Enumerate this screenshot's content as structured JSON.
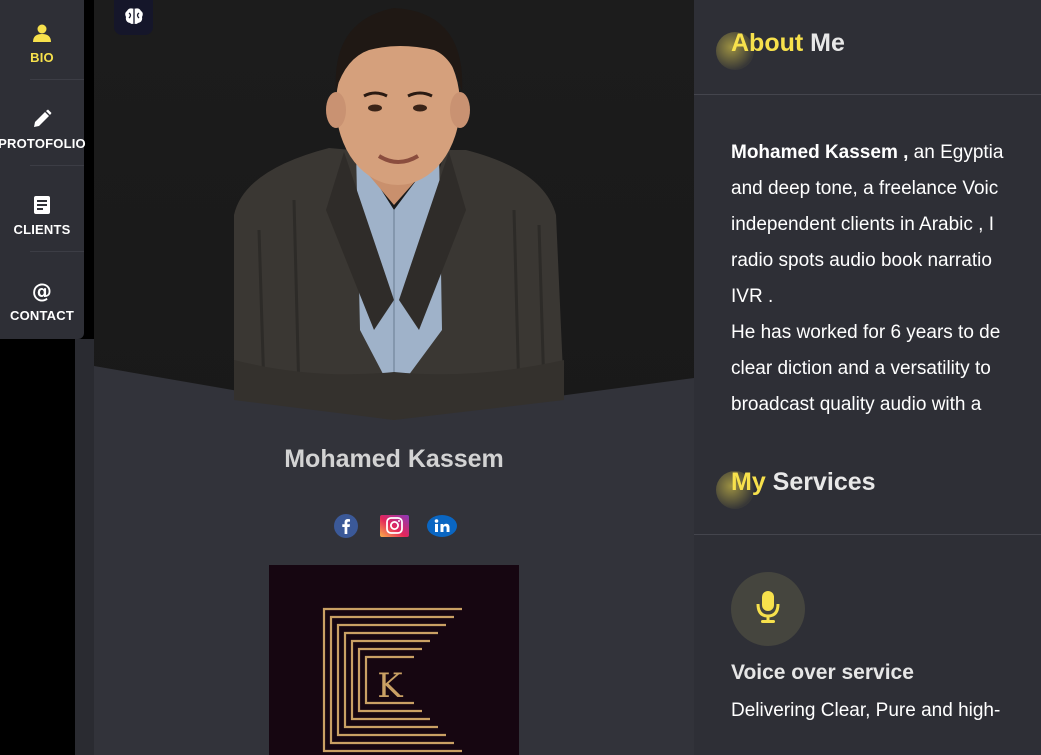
{
  "menu": {
    "items": [
      {
        "label": "BIO",
        "icon": "user-icon",
        "active": true
      },
      {
        "label": "PROTOFOLIO",
        "icon": "pencil-icon",
        "active": false
      },
      {
        "label": "CLIENTS",
        "icon": "document-icon",
        "active": false
      },
      {
        "label": "CONTACT",
        "icon": "at-icon",
        "active": false
      }
    ]
  },
  "profile": {
    "name": "Mohamed Kassem",
    "toolbar_icon": "brain-icon",
    "socials": [
      {
        "icon": "facebook-icon"
      },
      {
        "icon": "instagram-icon"
      },
      {
        "icon": "linkedin-icon"
      }
    ],
    "logo": {
      "letter": "K",
      "color": "#c9a064",
      "background": "#160611"
    }
  },
  "about": {
    "title_highlight": "About",
    "title_rest": " Me",
    "paragraph_lines": [
      {
        "bold": "Mohamed Kassem ,",
        "text": " an Egyptia"
      },
      {
        "bold": "",
        "text": "and deep tone, a freelance Voic"
      },
      {
        "bold": "",
        "text": "independent clients in Arabic , I"
      },
      {
        "bold": "",
        "text": "radio spots audio book narratio"
      },
      {
        "bold": "",
        "text": "IVR ."
      },
      {
        "bold": "",
        "text": "He has worked for 6 years to de"
      },
      {
        "bold": "",
        "text": "clear diction and a versatility to"
      },
      {
        "bold": "",
        "text": "broadcast quality audio with a"
      }
    ]
  },
  "services": {
    "title_highlight": "My",
    "title_rest": " Services",
    "items": [
      {
        "icon": "microphone-icon",
        "title": "Voice over service",
        "description": "Delivering Clear, Pure and high-"
      }
    ]
  },
  "colors": {
    "accent": "#f7e14c",
    "sidebar_bg": "#2e2f36",
    "card_bg": "#32333a",
    "facebook": "#3b5998",
    "linkedin": "#0a66c2"
  }
}
